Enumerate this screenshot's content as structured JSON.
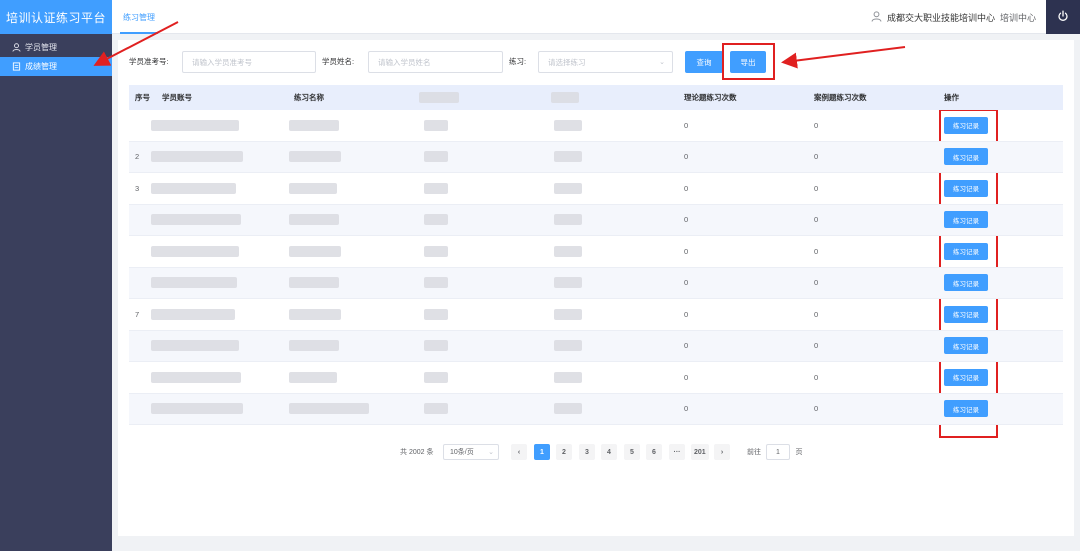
{
  "app": {
    "title": "培训认证练习平台"
  },
  "sidebar": {
    "items": [
      {
        "label": "学员管理",
        "icon": "user-icon"
      },
      {
        "label": "成绩管理",
        "icon": "document-icon",
        "active": true
      }
    ]
  },
  "header": {
    "tab": "练习管理",
    "org": "成都交大职业技能培训中心",
    "role": "培训中心"
  },
  "filters": {
    "exam_no_label": "学员准考号:",
    "exam_no_placeholder": "请输入学员准考号",
    "name_label": "学员姓名:",
    "name_placeholder": "请输入学员姓名",
    "practice_label": "练习:",
    "practice_placeholder": "请选择练习",
    "query_button": "查询",
    "export_button": "导出"
  },
  "table": {
    "columns": [
      "序号",
      "学员账号",
      "练习名称",
      "",
      "",
      "理论题练习次数",
      "案例题练习次数",
      "操作"
    ],
    "rows": [
      {
        "index": "",
        "theory": "0",
        "case": "0",
        "action": "练习记录"
      },
      {
        "index": "2",
        "theory": "0",
        "case": "0",
        "action": "练习记录"
      },
      {
        "index": "3",
        "theory": "0",
        "case": "0",
        "action": "练习记录"
      },
      {
        "index": "",
        "theory": "0",
        "case": "0",
        "action": "练习记录"
      },
      {
        "index": "",
        "theory": "0",
        "case": "0",
        "action": "练习记录"
      },
      {
        "index": "",
        "theory": "0",
        "case": "0",
        "action": "练习记录"
      },
      {
        "index": "7",
        "theory": "0",
        "case": "0",
        "action": "练习记录"
      },
      {
        "index": "",
        "theory": "0",
        "case": "0",
        "action": "练习记录"
      },
      {
        "index": "",
        "theory": "0",
        "case": "0",
        "action": "练习记录"
      },
      {
        "index": "",
        "theory": "0",
        "case": "0",
        "action": "练习记录"
      }
    ]
  },
  "pagination": {
    "total": "共 2002 条",
    "page_size": "10条/页",
    "pages": [
      "1",
      "2",
      "3",
      "4",
      "5",
      "6",
      "···",
      "201"
    ],
    "current": "1",
    "goto_prefix": "前往",
    "goto_value": "1",
    "goto_suffix": "页"
  },
  "colors": {
    "accent": "#409eff",
    "sidebar": "#3a3f5c",
    "highlight": "#e02020"
  }
}
